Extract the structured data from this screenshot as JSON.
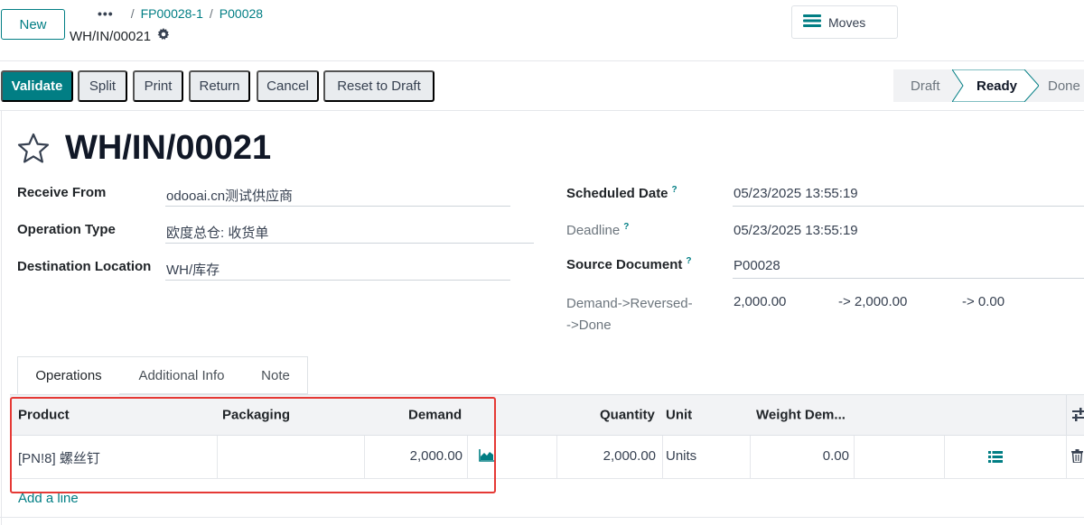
{
  "control": {
    "new_label": "New",
    "breadcrumb_more": "•••",
    "breadcrumb": [
      "FP00028-1",
      "P00028"
    ],
    "sub_record": "WH/IN/00021",
    "moves_label": "Moves"
  },
  "actions": [
    "Validate",
    "Split",
    "Print",
    "Return",
    "Cancel",
    "Reset to Draft"
  ],
  "status": {
    "stages": [
      "Draft",
      "Ready",
      "Done"
    ],
    "current": "Ready"
  },
  "record": {
    "title": "WH/IN/00021",
    "receive_from": {
      "label": "Receive From",
      "value": "odooai.cn测试供应商"
    },
    "operation_type": {
      "label": "Operation Type",
      "value": "欧度总仓: 收货单"
    },
    "destination": {
      "label": "Destination Location",
      "value": "WH/库存"
    },
    "scheduled_date": {
      "label": "Scheduled Date",
      "help": "?",
      "value": "05/23/2025 13:55:19"
    },
    "deadline": {
      "label": "Deadline",
      "help": "?",
      "value": "05/23/2025 13:55:19"
    },
    "source_document": {
      "label": "Source Document",
      "help": "?",
      "value": "P00028"
    },
    "demand_reversed": {
      "label_line1": "Demand->Reversed-",
      "label_line2": "->Done",
      "v1": "2,000.00",
      "v2": "-> 2,000.00",
      "v3": "-> 0.00"
    }
  },
  "tabs": [
    "Operations",
    "Additional Info",
    "Note"
  ],
  "table": {
    "headers": [
      "Product",
      "Packaging",
      "Demand",
      "Quantity",
      "Unit",
      "Weight Dem..."
    ],
    "row": {
      "product": "[PN!8] 螺丝钉",
      "packaging": "",
      "demand": "2,000.00",
      "quantity": "2,000.00",
      "unit": "Units",
      "weight": "0.00"
    },
    "add_line": "Add a line"
  },
  "colors": {
    "primary": "#017e84",
    "highlight": "#e53935"
  }
}
